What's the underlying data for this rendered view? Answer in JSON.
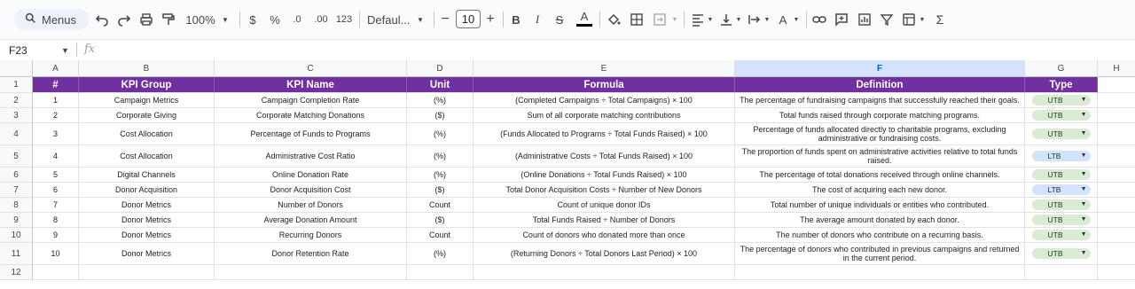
{
  "toolbar": {
    "menus_label": "Menus",
    "zoom": "100%",
    "currency": "$",
    "percent": "%",
    "dec_decrease": ".0",
    "dec_increase": ".00",
    "number_format": "123",
    "font_name": "Defaul...",
    "font_size": "10",
    "icons": [
      "search-icon",
      "undo-icon",
      "redo-icon",
      "print-icon",
      "paint-format-icon",
      "bold-icon",
      "italic-icon",
      "strikethrough-icon",
      "text-color-icon",
      "fill-color-icon",
      "borders-icon",
      "merge-cells-icon",
      "align-left-icon",
      "valign-bottom-icon",
      "text-wrap-icon",
      "text-rotation-icon",
      "link-icon",
      "comment-icon",
      "filter-icon",
      "functions-menu-icon",
      "sigma-icon"
    ]
  },
  "formula_bar": {
    "cell_ref": "F23",
    "fx": "fx"
  },
  "columns": [
    "A",
    "B",
    "C",
    "D",
    "E",
    "F",
    "G",
    "H"
  ],
  "rows": [
    "1",
    "2",
    "3",
    "4",
    "5",
    "6",
    "7",
    "8",
    "9",
    "10",
    "11",
    "12"
  ],
  "table": {
    "headers": [
      "#",
      "KPI Group",
      "KPI Name",
      "Unit",
      "Formula",
      "Definition",
      "Type"
    ],
    "rows": [
      [
        "1",
        "Campaign Metrics",
        "Campaign Completion Rate",
        "(%)",
        "(Completed Campaigns ÷ Total Campaigns) × 100",
        "The percentage of fundraising campaigns that successfully reached their goals.",
        "UTB"
      ],
      [
        "2",
        "Corporate Giving",
        "Corporate Matching Donations",
        "($)",
        "Sum of all corporate matching contributions",
        "Total funds raised through corporate matching programs.",
        "UTB"
      ],
      [
        "3",
        "Cost Allocation",
        "Percentage of Funds to Programs",
        "(%)",
        "(Funds Allocated to Programs ÷ Total Funds Raised) × 100",
        "Percentage of funds allocated directly to charitable programs, excluding administrative or fundraising costs.",
        "UTB"
      ],
      [
        "4",
        "Cost Allocation",
        "Administrative Cost Ratio",
        "(%)",
        "(Administrative Costs ÷ Total Funds Raised) × 100",
        "The proportion of funds spent on administrative activities relative to total funds raised.",
        "LTB"
      ],
      [
        "5",
        "Digital Channels",
        "Online Donation Rate",
        "(%)",
        "(Online Donations ÷ Total Funds Raised) × 100",
        "The percentage of total donations received through online channels.",
        "UTB"
      ],
      [
        "6",
        "Donor Acquisition",
        "Donor Acquisition Cost",
        "($)",
        "Total Donor Acquisition Costs ÷ Number of New Donors",
        "The cost of acquiring each new donor.",
        "LTB"
      ],
      [
        "7",
        "Donor Metrics",
        "Number of Donors",
        "Count",
        "Count of unique donor IDs",
        "Total number of unique individuals or entities who contributed.",
        "UTB"
      ],
      [
        "8",
        "Donor Metrics",
        "Average Donation Amount",
        "($)",
        "Total Funds Raised ÷ Number of Donors",
        "The average amount donated by each donor.",
        "UTB"
      ],
      [
        "9",
        "Donor Metrics",
        "Recurring Donors",
        "Count",
        "Count of donors who donated more than once",
        "The number of donors who contribute on a recurring basis.",
        "UTB"
      ],
      [
        "10",
        "Donor Metrics",
        "Donor Retention Rate",
        "(%)",
        "(Returning Donors ÷ Total Donors Last Period) × 100",
        "The percentage of donors who contributed in previous campaigns and returned in the current period.",
        "UTB"
      ]
    ]
  },
  "colors": {
    "header_bg": "#7030a0",
    "utb_chip": "#d9ebd3",
    "ltb_chip": "#d3e3fd",
    "selected_col": "#d3e3fd"
  }
}
